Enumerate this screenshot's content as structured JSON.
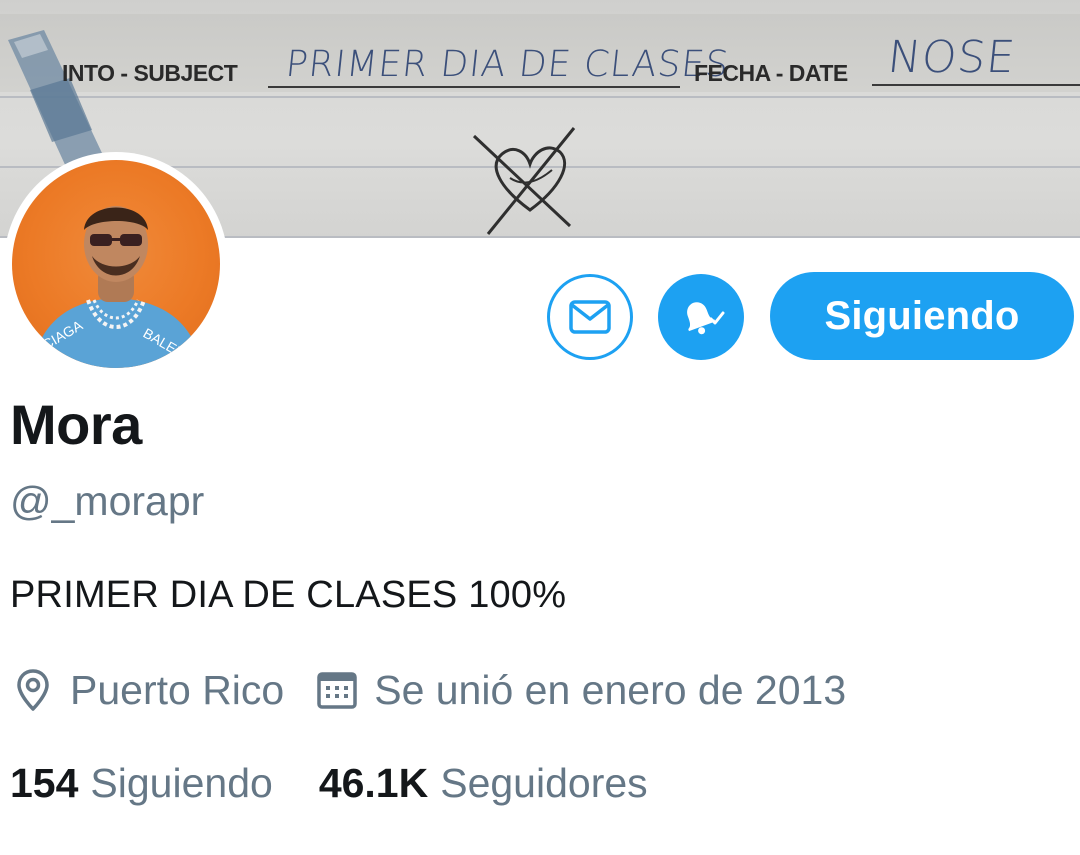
{
  "banner": {
    "subject_printed": "INTO - SUBJECT",
    "subject_handwritten": "PRIMER DIA DE CLASES",
    "date_printed": "FECHA - DATE",
    "date_handwritten": "NOSE"
  },
  "actions": {
    "follow_label": "Siguiendo"
  },
  "profile": {
    "name": "Mora",
    "handle": "@_morapr",
    "bio": "PRIMER DIA DE CLASES 100%",
    "location": "Puerto Rico",
    "joined": "Se unió en enero de 2013"
  },
  "stats": {
    "following_count": "154",
    "following_label": "Siguiendo",
    "followers_count": "46.1K",
    "followers_label": "Seguidores"
  },
  "icons": {
    "message": "envelope-icon",
    "notifications": "bell-icon",
    "location": "location-pin-icon",
    "calendar": "calendar-icon"
  },
  "colors": {
    "accent": "#1da1f2",
    "text_primary": "#14171a",
    "text_secondary": "#657786",
    "avatar_bg": "#ec7a26"
  }
}
